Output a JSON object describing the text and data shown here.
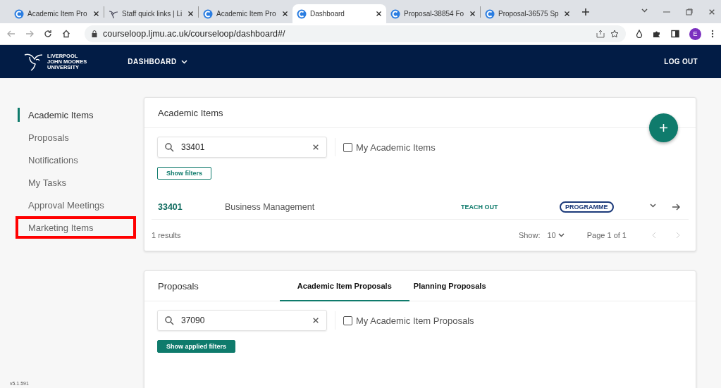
{
  "browser": {
    "tabs": [
      {
        "title": "Academic Item Pro",
        "selected": false
      },
      {
        "title": "Staff quick links | Li",
        "selected": false
      },
      {
        "title": "Academic Item Pro",
        "selected": false
      },
      {
        "title": "Dashboard",
        "selected": true
      },
      {
        "title": "Proposal-38854 Fo",
        "selected": false
      },
      {
        "title": "Proposal-36575 Sp",
        "selected": false
      }
    ],
    "url": "courseloop.ljmu.ac.uk/courseloop/dashboard#/",
    "profile": "E"
  },
  "header": {
    "logo": [
      "LIVERPOOL",
      "JOHN MOORES",
      "UNIVERSITY"
    ],
    "menu": "DASHBOARD",
    "logout": "LOG OUT"
  },
  "sidebar": {
    "items": [
      {
        "label": "Academic Items",
        "selected": true,
        "highlighted": false
      },
      {
        "label": "Proposals",
        "selected": false,
        "highlighted": false
      },
      {
        "label": "Notifications",
        "selected": false,
        "highlighted": false
      },
      {
        "label": "My Tasks",
        "selected": false,
        "highlighted": false
      },
      {
        "label": "Approval Meetings",
        "selected": false,
        "highlighted": false
      },
      {
        "label": "Marketing Items",
        "selected": false,
        "highlighted": true
      }
    ],
    "version": "v5.1.591"
  },
  "academic_items": {
    "title": "Academic Items",
    "search": {
      "value": "33401"
    },
    "my_items": {
      "label": "My Academic Items",
      "checked": false
    },
    "filter_button": "Show filters",
    "rows": [
      {
        "code": "33401",
        "name": "Business Management",
        "status": "TEACH OUT",
        "type": "PROGRAMME"
      }
    ],
    "results": "1 results",
    "show_label": "Show:",
    "page_size": "10",
    "page": "Page 1 of 1"
  },
  "proposals": {
    "title": "Proposals",
    "tabs": [
      {
        "label": "Academic Item Proposals",
        "selected": true
      },
      {
        "label": "Planning Proposals",
        "selected": false
      }
    ],
    "search": {
      "value": "37090"
    },
    "my_items": {
      "label": "My Academic Item Proposals",
      "checked": false
    },
    "filter_button": "Show applied filters"
  }
}
